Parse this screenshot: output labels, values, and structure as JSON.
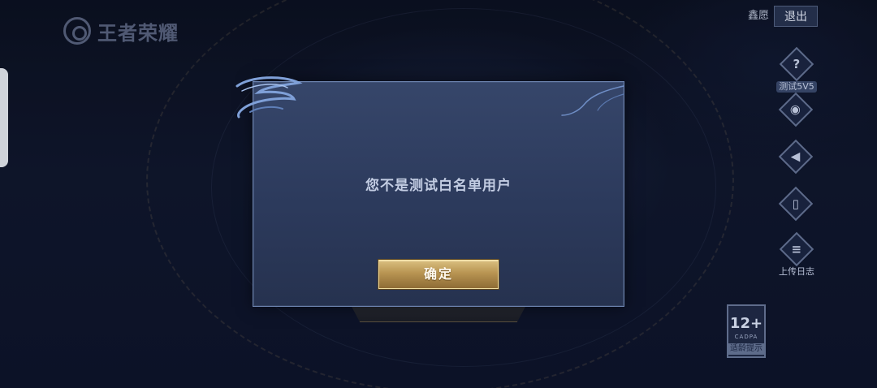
{
  "app": {
    "logo_text": "王者荣耀"
  },
  "header": {
    "user_name": "鑫愿",
    "logout_label": "退出"
  },
  "side_menu": {
    "items": [
      {
        "label": "测试5V5",
        "icon": "question-icon",
        "glyph": "?"
      },
      {
        "label": "",
        "icon": "gamepad-icon",
        "glyph": "◉"
      },
      {
        "label": "",
        "icon": "speaker-icon",
        "glyph": "◀"
      },
      {
        "label": "",
        "icon": "phone-icon",
        "glyph": "▯"
      },
      {
        "label": "上传日志",
        "icon": "clipboard-icon",
        "glyph": "≡"
      }
    ]
  },
  "age_rating": {
    "age": "12+",
    "org": "CADPA",
    "tip": "适龄提示"
  },
  "dialog": {
    "message": "您不是测试白名单用户",
    "confirm_label": "确定"
  },
  "colors": {
    "dialog_bg": "#2c3a5c",
    "dialog_border": "#6d84b0",
    "confirm_gold": "#b89452"
  }
}
